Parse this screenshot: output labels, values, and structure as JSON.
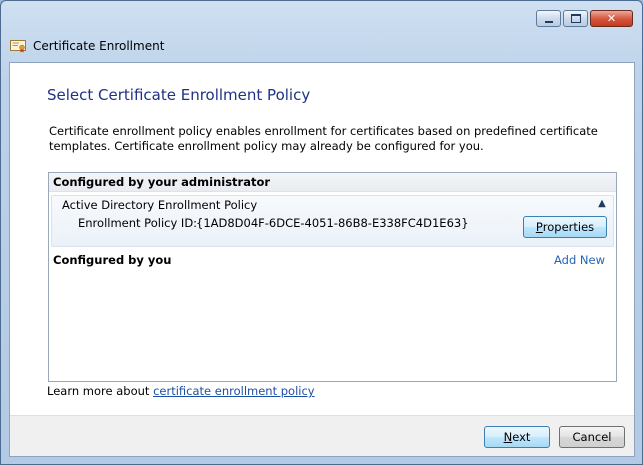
{
  "window": {
    "title": "Certificate Enrollment",
    "controls": {
      "minimize": "minimize-icon",
      "maximize": "maximize-icon",
      "close": "close-icon",
      "close_glyph": "✕"
    }
  },
  "page": {
    "heading": "Select Certificate Enrollment Policy",
    "description": "Certificate enrollment policy enables enrollment for certificates based on predefined certificate templates. Certificate enrollment policy may already be configured for you."
  },
  "admin_group": {
    "header": "Configured by your administrator",
    "policy": {
      "name": "Active Directory Enrollment Policy",
      "id_label": "Enrollment Policy ID:",
      "id_value": "{1AD8D04F-6DCE-4051-86B8-E338FC4D1E63}",
      "properties_button": {
        "accel": "P",
        "rest": "roperties"
      },
      "collapse_glyph": "▲"
    }
  },
  "user_group": {
    "header": "Configured by you",
    "add_new": "Add New"
  },
  "learn_more": {
    "prefix": "Learn more about ",
    "link": "certificate enrollment policy"
  },
  "footer": {
    "next": {
      "accel": "N",
      "rest": "ext"
    },
    "cancel": "Cancel"
  }
}
